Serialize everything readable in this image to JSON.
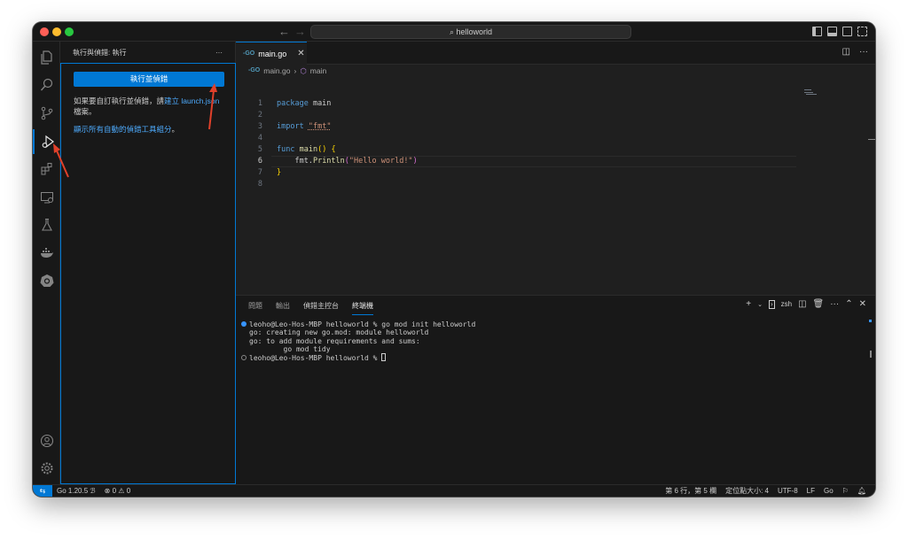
{
  "window": {
    "title": "helloworld"
  },
  "sidebar": {
    "title": "執行與偵錯: 執行",
    "more_label": "···",
    "run_button": "執行並偵錯",
    "custom_text": "如果要自訂執行並偵錯，請",
    "create_link": "建立 launch.json",
    "file_text": "檔案。",
    "show_all_link": "顯示所有自動的偵錯工具組分",
    "show_all_suffix": "。"
  },
  "tab": {
    "label": "main.go",
    "icon": "go-file-icon",
    "icon_text": "-GO"
  },
  "breadcrumbs": [
    "main.go",
    "main"
  ],
  "editor": {
    "lines": [
      {
        "num": "1",
        "text": "package main"
      },
      {
        "num": "2",
        "text": ""
      },
      {
        "num": "3",
        "text": "import \"fmt\""
      },
      {
        "num": "4",
        "text": ""
      },
      {
        "num": "5",
        "text": "func main() {"
      },
      {
        "num": "6",
        "text": "    fmt.Println(\"Hello world!\")"
      },
      {
        "num": "7",
        "text": "}"
      },
      {
        "num": "8",
        "text": ""
      }
    ],
    "current_line": 6
  },
  "panel": {
    "tabs": [
      "問題",
      "輸出",
      "偵錯主控台",
      "終端機"
    ],
    "active_tab": "終端機",
    "shell_label": "zsh",
    "terminal_lines": [
      "leoho@Leo-Hos-MBP helloworld % go mod init helloworld",
      "go: creating new go.mod: module helloworld",
      "go: to add module requirements and sums:",
      "        go mod tidy",
      "leoho@Leo-Hos-MBP helloworld % "
    ]
  },
  "statusbar": {
    "go_version": "Go 1.20.5",
    "errors": "0",
    "warnings": "0",
    "position": "第 6 行，第 5 欄",
    "indent": "定位點大小: 4",
    "encoding": "UTF-8",
    "eol": "LF",
    "language": "Go"
  },
  "colors": {
    "accent": "#0078d4",
    "annotation_arrow": "#e0402a"
  }
}
